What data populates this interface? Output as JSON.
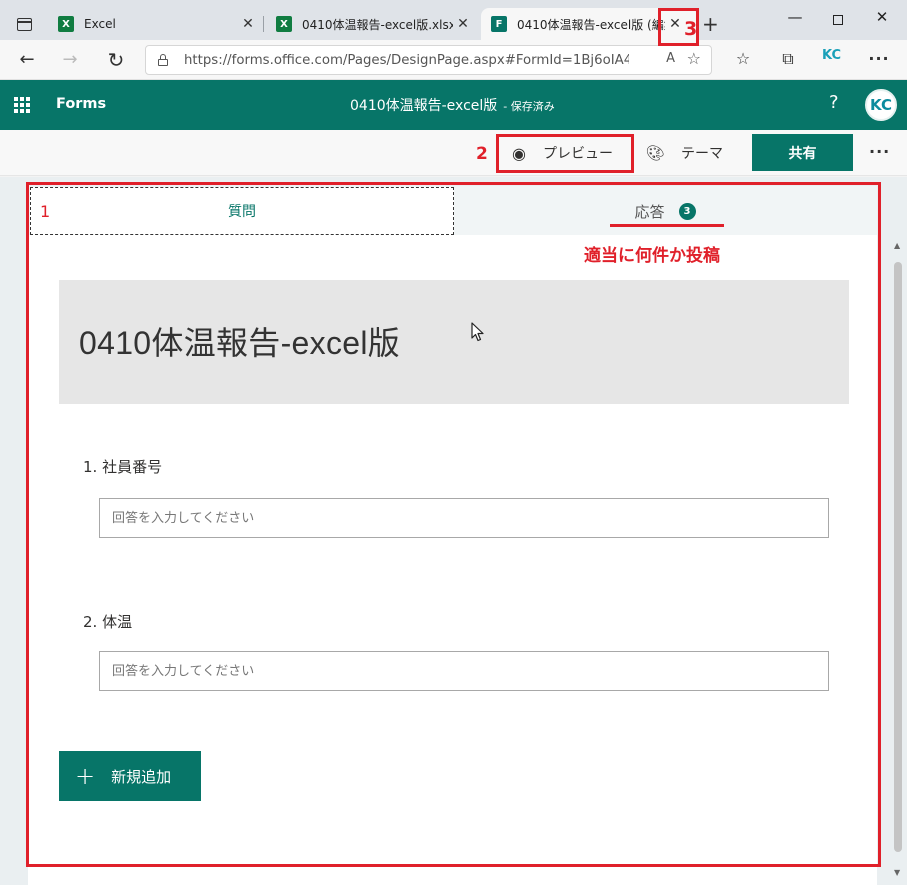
{
  "browser": {
    "tabs": [
      {
        "title": "Excel",
        "favicon": "excel-icon"
      },
      {
        "title": "0410体温報告-excel版.xlsx",
        "favicon": "excel-icon"
      },
      {
        "title": "0410体温報告-excel版 (編集",
        "favicon": "forms-icon"
      }
    ],
    "url": "https://forms.office.com/Pages/DesignPage.aspx#FormId=1Bj6oIA4pE...",
    "profile_initials": "KC"
  },
  "forms_header": {
    "app_name": "Forms",
    "form_title": "0410体温報告-excel版",
    "save_status": "- 保存済み",
    "help": "?",
    "user_initials": "KC"
  },
  "commands": {
    "preview": "プレビュー",
    "theme": "テーマ",
    "share": "共有",
    "more": "···"
  },
  "tabs": {
    "questions": "質問",
    "responses": "応答",
    "responses_count": "3"
  },
  "form": {
    "title": "0410体温報告-excel版",
    "questions": [
      {
        "label": "1. 社員番号",
        "placeholder": "回答を入力してください"
      },
      {
        "label": "2. 体温",
        "placeholder": "回答を入力してください"
      }
    ],
    "add_new": "新規追加"
  },
  "annotations": {
    "num1": "1",
    "num2": "2",
    "num3": "3",
    "note": "適当に何件か投稿",
    "color": "#e0202a"
  },
  "theme_colors": {
    "brand": "#077568",
    "excel": "#107c41"
  }
}
